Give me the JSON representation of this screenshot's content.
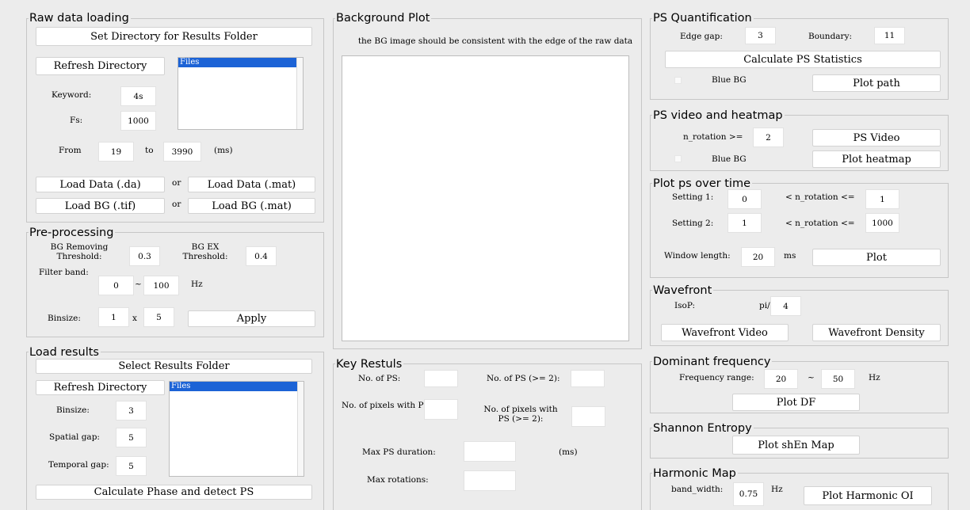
{
  "raw": {
    "title": "Raw data loading",
    "set_dir": "Set Directory for Results Folder",
    "refresh": "Refresh Directory",
    "files_selected": "Files",
    "keyword_label": "Keyword:",
    "keyword_value": "4s",
    "fs_label": "Fs:",
    "fs_value": "1000",
    "from_label": "From",
    "from_value": "19",
    "to_label": "to",
    "to_value": "3990",
    "ms_unit": "(ms)",
    "load_da": "Load Data (.da)",
    "or1": "or",
    "load_mat": "Load Data (.mat)",
    "load_bg_tif": "Load BG (.tif)",
    "or2": "or",
    "load_bg_mat": "Load BG (.mat)"
  },
  "pre": {
    "title": "Pre-processing",
    "bg_remove_label": "BG Removing Threshold:",
    "bg_remove_value": "0.3",
    "bg_ex_label": "BG EX Threshold:",
    "bg_ex_value": "0.4",
    "filter_label": "Filter band:",
    "filter_low": "0",
    "tilde": "~",
    "filter_high": "100",
    "hz": "Hz",
    "binsize_label": "Binsize:",
    "bin_x": "1",
    "times": "x",
    "bin_y": "5",
    "apply": "Apply"
  },
  "load_results": {
    "title": "Load results",
    "select_folder": "Select Results Folder",
    "refresh": "Refresh Directory",
    "files_selected": "Files",
    "binsize_label": "Binsize:",
    "binsize_value": "3",
    "spatial_label": "Spatial gap:",
    "spatial_value": "5",
    "temporal_label": "Temporal gap:",
    "temporal_value": "5",
    "calc_phase": "Calculate Phase and detect PS"
  },
  "bg_plot": {
    "title": "Background Plot",
    "note": "the BG image should be consistent with the edge of the raw data"
  },
  "key": {
    "title": "Key Restuls",
    "num_ps_label": "No. of PS:",
    "num_ps2_label": "No. of PS (>= 2):",
    "pix_label": "No. of pixels with PS:",
    "pix2_label": "No. of pixels with PS (>= 2):",
    "max_dur_label": "Max PS duration:",
    "ms_unit": "(ms)",
    "max_rot_label": "Max rotations:"
  },
  "psq": {
    "title": "PS Quantification",
    "edge_label": "Edge gap:",
    "edge_value": "3",
    "boundary_label": "Boundary:",
    "boundary_value": "11",
    "calc": "Calculate PS Statistics",
    "blue_bg": "Blue BG",
    "plot_path": "Plot path"
  },
  "psvid": {
    "title": "PS video and heatmap",
    "nrot_label": "n_rotation >=",
    "nrot_value": "2",
    "ps_video": "PS Video",
    "blue_bg": "Blue BG",
    "plot_heatmap": "Plot heatmap"
  },
  "psot": {
    "title": "Plot ps over time",
    "s1_label": "Setting 1:",
    "s1_low": "0",
    "s1_mid": "< n_rotation <=",
    "s1_high": "1",
    "s2_label": "Setting 2:",
    "s2_low": "1",
    "s2_mid": "< n_rotation <=",
    "s2_high": "1000",
    "win_label": "Window length:",
    "win_value": "20",
    "ms": "ms",
    "plot": "Plot"
  },
  "wave": {
    "title": "Wavefront",
    "isop_label": "IsoP:",
    "pi_label": "pi/",
    "pi_value": "4",
    "video": "Wavefront Video",
    "density": "Wavefront Density"
  },
  "dom": {
    "title": "Dominant frequency",
    "range_label": "Frequency range:",
    "low": "20",
    "tilde": "~",
    "high": "50",
    "hz": "Hz",
    "plot_df": "Plot DF"
  },
  "shannon": {
    "title": "Shannon Entropy",
    "plot": "Plot shEn Map"
  },
  "harm": {
    "title": "Harmonic Map",
    "bw_label": "band_width:",
    "bw_value": "0.75",
    "hz": "Hz",
    "plot": "Plot Harmonic OI"
  }
}
